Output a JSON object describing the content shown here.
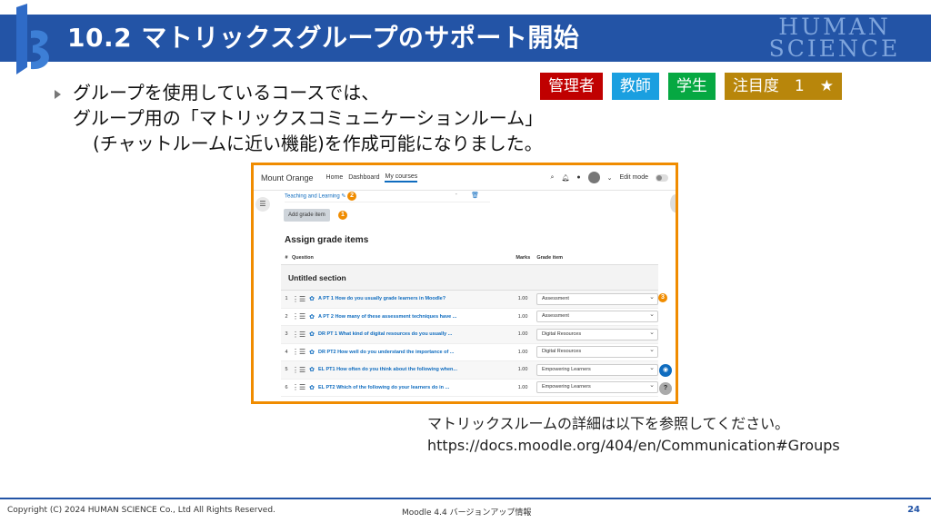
{
  "slide": {
    "title": "10.2 マトリックスグループのサポート開始",
    "brand_line1": "HUMAN",
    "brand_line2": "SCIENCE"
  },
  "badges": {
    "admin": "管理者",
    "teacher": "教師",
    "student": "学生",
    "attention": "注目度　1　★"
  },
  "bullet": {
    "line1": "グループを使用しているコースでは、",
    "line2": "グループ用の「マトリックスコミュニケーションルーム」",
    "line3": "(チャットルームに近い機能)を作成可能になりました。"
  },
  "moodle": {
    "site_name": "Mount Orange",
    "nav": [
      "Home",
      "Dashboard",
      "My courses"
    ],
    "edit_mode": "Edit mode",
    "subline": "Teaching and Learning",
    "dash": "-",
    "add_button": "Add grade item",
    "heading": "Assign grade items",
    "columns": {
      "num": "#",
      "question": "Question",
      "marks": "Marks",
      "grade": "Grade item"
    },
    "section": "Untitled section",
    "rows": [
      {
        "num": "1",
        "question": "A PT 1 How do you usually grade learners in Moodle?",
        "marks": "1.00",
        "grade": "Assessment"
      },
      {
        "num": "2",
        "question": "A PT 2 How many of these assessment techniques have ...",
        "marks": "1.00",
        "grade": "Assessment"
      },
      {
        "num": "3",
        "question": "DR PT 1 What kind of digital resources do you usually ...",
        "marks": "1.00",
        "grade": "Digital Resources"
      },
      {
        "num": "4",
        "question": "DR PT2 How well do you understand the importance of ...",
        "marks": "1.00",
        "grade": "Digital Resources"
      },
      {
        "num": "5",
        "question": "EL PT1 How often do you think about the following when...",
        "marks": "1.00",
        "grade": "Empowering Learners"
      },
      {
        "num": "6",
        "question": "EL PT2 Which of the following do your learners do in ...",
        "marks": "1.00",
        "grade": "Empowering Learners"
      }
    ],
    "callouts": [
      "1",
      "2",
      "3"
    ],
    "help": "?"
  },
  "note": {
    "line1": "マトリックスルームの詳細は以下を参照してください。",
    "line2": "https://docs.moodle.org/404/en/Communication#Groups"
  },
  "footer": {
    "copyright": "Copyright (C) 2024 HUMAN SCIENCE Co., Ltd All Rights Reserved.",
    "center": "Moodle 4.4 バージョンアップ情報",
    "page": "24"
  },
  "colors": {
    "title_bar": "#2354a6",
    "accent": "#f08c00",
    "link": "#0f6cbf"
  }
}
